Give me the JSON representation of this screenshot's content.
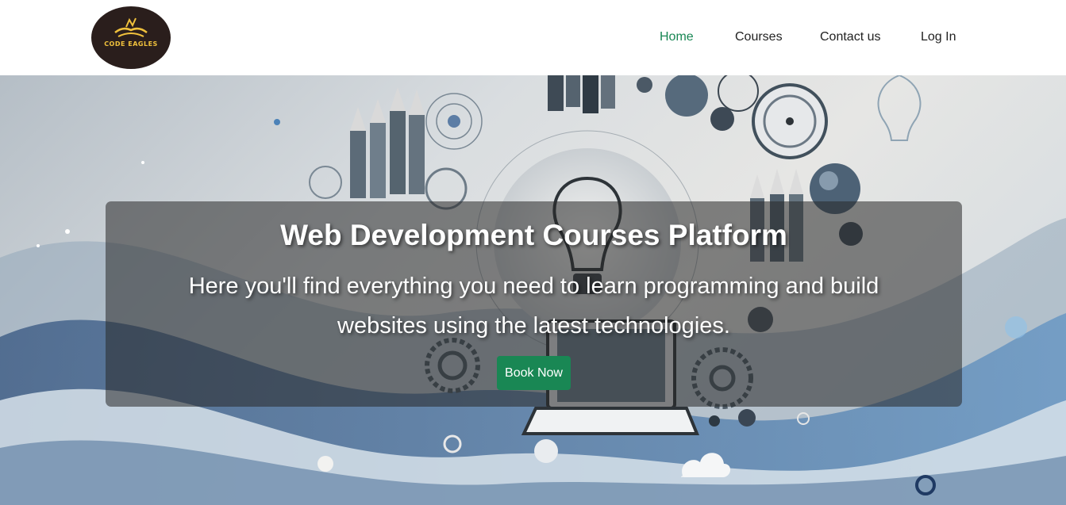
{
  "brand": {
    "logo_text": "CODE EAGLES",
    "logo_icon": "eagle-icon"
  },
  "nav": {
    "items": [
      {
        "label": "Home",
        "active": true
      },
      {
        "label": "Courses",
        "active": false
      },
      {
        "label": "Contact us",
        "active": false
      },
      {
        "label": "Log In",
        "active": false
      }
    ]
  },
  "hero": {
    "title": "Web Development Courses Platform",
    "subtitle_line1": "Here you'll find everything you need to learn programming and build",
    "subtitle_line2": "websites using the latest technologies.",
    "cta_label": "Book Now"
  },
  "colors": {
    "accent": "#198754",
    "nav_text": "#222222",
    "logo_bg": "#2a1e1c",
    "logo_gold": "#f0c13c"
  }
}
